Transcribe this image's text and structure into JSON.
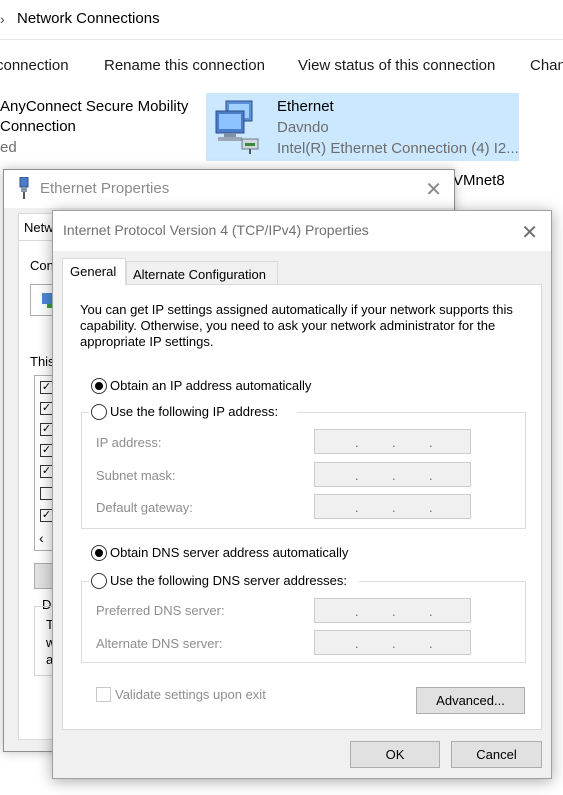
{
  "explorer": {
    "breadcrumb_chevron": "›",
    "title": "Network Connections",
    "commands": [
      "connection",
      "Rename this connection",
      "View status of this connection",
      "Chan"
    ],
    "anyconnect": {
      "name": "AnyConnect Secure Mobility",
      "subtitle": "Connection",
      "status": "ed"
    },
    "ethernet_tile": {
      "name": "Ethernet",
      "domain": "Davndo",
      "device": "Intel(R) Ethernet Connection (4) I2...",
      "icon": "network-computers-icon"
    },
    "vmnet": "VMnet8"
  },
  "ethernet_properties": {
    "title": "Ethernet Properties",
    "close": "✕",
    "tab_partial": "Netw",
    "connect_partial": "Con",
    "this_partial": "This",
    "d_partial": "D",
    "desc_chars": [
      "T",
      "w",
      "a"
    ],
    "scroll_left": "‹",
    "checkbox_states": [
      true,
      true,
      true,
      true,
      true,
      false,
      true
    ]
  },
  "ipv4_dialog": {
    "title": "Internet Protocol Version 4 (TCP/IPv4) Properties",
    "close": "✕",
    "tabs": {
      "general": "General",
      "alternate": "Alternate Configuration"
    },
    "intro": "You can get IP settings assigned automatically if your network supports this capability. Otherwise, you need to ask your network administrator for the appropriate IP settings.",
    "ip": {
      "auto_label": "Obtain an IP address automatically",
      "manual_label": "Use the following IP address:",
      "selected": "auto",
      "fields": {
        "ip_address": "IP address:",
        "subnet_mask": "Subnet mask:",
        "default_gateway": "Default gateway:"
      }
    },
    "dns": {
      "auto_label": "Obtain DNS server address automatically",
      "manual_label": "Use the following DNS server addresses:",
      "selected": "auto",
      "fields": {
        "preferred": "Preferred DNS server:",
        "alternate": "Alternate DNS server:"
      }
    },
    "ip_separator": ".",
    "validate_label": "Validate settings upon exit",
    "validate_checked": false,
    "buttons": {
      "advanced": "Advanced...",
      "ok": "OK",
      "cancel": "Cancel"
    }
  }
}
